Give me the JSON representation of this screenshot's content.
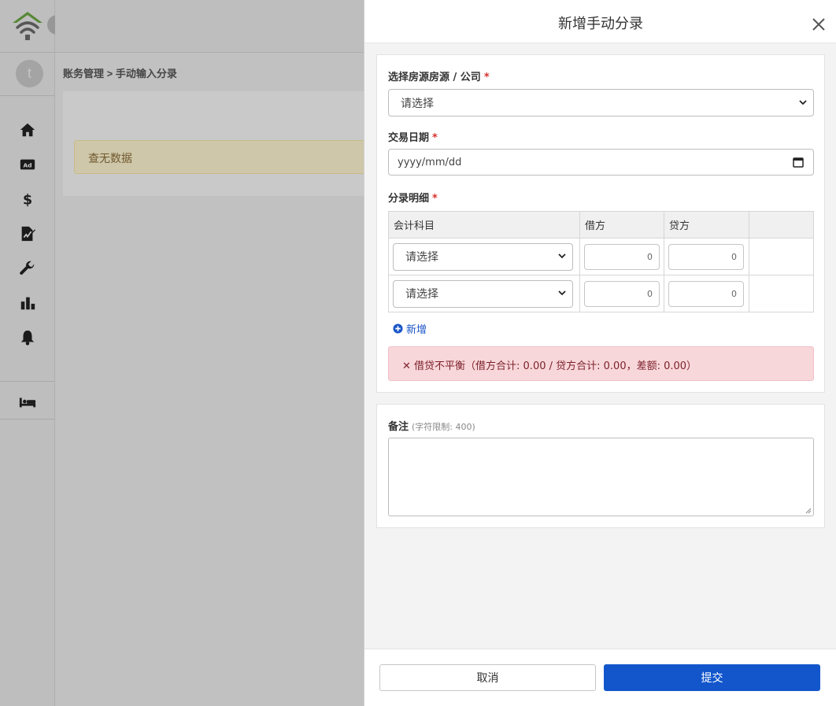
{
  "colors": {
    "primary": "#1356cc",
    "required": "#d9302c",
    "alert_bg": "#f8d7da",
    "no_data_bg": "#fcf3cf",
    "logo_green": "#6aa743"
  },
  "sidebar": {
    "avatar_letter": "t",
    "expand_icon": "chevron-right-icon",
    "items": [
      {
        "icon": "home-icon"
      },
      {
        "icon": "ad-icon",
        "text": "Ad"
      },
      {
        "icon": "dollar-icon",
        "text": "$"
      },
      {
        "icon": "document-sign-icon"
      },
      {
        "icon": "wrench-icon"
      },
      {
        "icon": "bar-chart-icon"
      },
      {
        "icon": "bell-icon"
      },
      {
        "icon": "bed-icon"
      }
    ]
  },
  "page": {
    "breadcrumb": "账务管理 > 手动输入分录",
    "no_data": "查无数据"
  },
  "modal": {
    "title": "新增手动分录",
    "close_icon": "close-icon",
    "property_label": "选择房源房源 / 公司",
    "required_mark": "*",
    "property_placeholder": "请选择",
    "date_label": "交易日期",
    "date_placeholder": "yyyy/mm/dd",
    "entries_label": "分录明细",
    "table": {
      "headers": [
        "会计科目",
        "借方",
        "贷方",
        ""
      ],
      "rows": [
        {
          "account": "请选择",
          "debit": "0",
          "credit": "0"
        },
        {
          "account": "请选择",
          "debit": "0",
          "credit": "0"
        }
      ]
    },
    "add_label": "新增",
    "alert_text": "✕ 借贷不平衡（借方合计: 0.00 / 贷方合计: 0.00，差额: 0.00）",
    "notes_label": "备注",
    "notes_hint": "(字符限制: 400)",
    "notes_value": "",
    "cancel_label": "取消",
    "submit_label": "提交"
  }
}
